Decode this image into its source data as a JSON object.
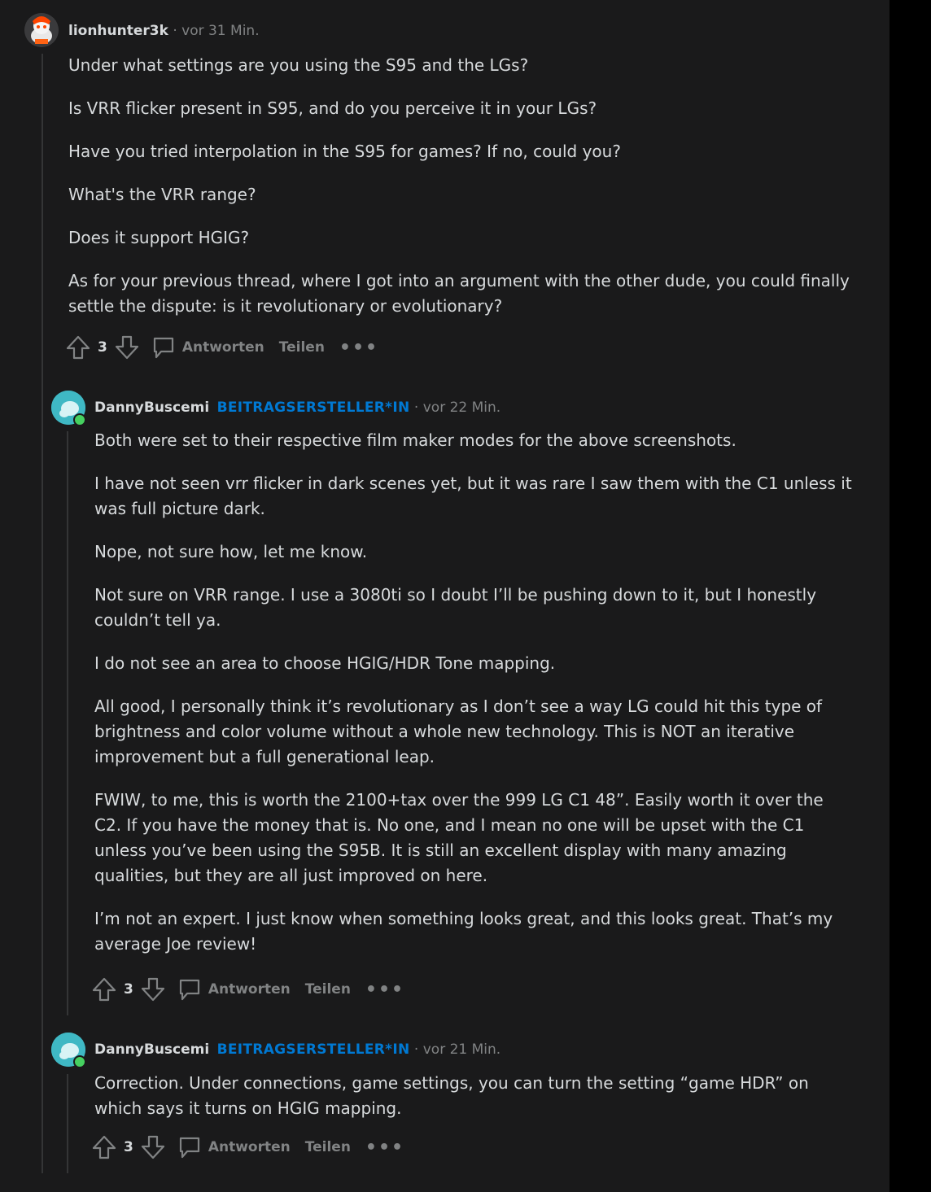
{
  "comments": [
    {
      "user": "lionhunter3k",
      "op_label": "",
      "time": "· vor 31 Min.",
      "paragraphs": [
        "Under what settings are you using the S95 and the LGs?",
        "Is VRR flicker present in S95, and do you perceive it in your LGs?",
        "Have you tried interpolation in the S95 for games? If no, could you?",
        "What's the VRR range?",
        "Does it support HGIG?",
        "As for your previous thread, where I got into an argument with the other dude, you could finally settle the dispute: is it revolutionary or evolutionary?"
      ],
      "score": "3",
      "reply": "Antworten",
      "share": "Teilen",
      "more": "•••"
    },
    {
      "user": "DannyBuscemi",
      "op_label": "BEITRAGSERSTELLER*IN",
      "time": "· vor 22 Min.",
      "paragraphs": [
        "Both were set to their respective film maker modes for the above screenshots.",
        "I have not seen vrr flicker in dark scenes yet, but it was rare I saw them with the C1 unless it was full picture dark.",
        "Nope, not sure how, let me know.",
        "Not sure on VRR range. I use a 3080ti so I doubt I’ll be pushing down to it, but I honestly couldn’t tell ya.",
        "I do not see an area to choose HGIG/HDR Tone mapping.",
        "All good, I personally think it’s revolutionary as I don’t see a way LG could hit this type of brightness and color volume without a whole new technology. This is NOT an iterative improvement but a full generational leap.",
        "FWIW, to me, this is worth the 2100+tax over the 999 LG C1 48”. Easily worth it over the C2. If you have the money that is. No one, and I mean no one will be upset with the C1 unless you’ve been using the S95B. It is still an excellent display with many amazing qualities, but they are all just improved on here.",
        "I’m not an expert. I just know when something looks great, and this looks great. That’s my average Joe review!"
      ],
      "score": "3",
      "reply": "Antworten",
      "share": "Teilen",
      "more": "•••"
    },
    {
      "user": "DannyBuscemi",
      "op_label": "BEITRAGSERSTELLER*IN",
      "time": "· vor 21 Min.",
      "paragraphs": [
        "Correction. Under connections, game settings, you can turn the setting “game HDR” on which says it turns on HGIG mapping."
      ],
      "score": "3",
      "reply": "Antworten",
      "share": "Teilen",
      "more": "•••"
    }
  ],
  "colors": {
    "background": "#1a1a1b",
    "text": "#d7dadc",
    "meta": "#818384",
    "op": "#0079d3",
    "online": "#46d160"
  },
  "icons": {
    "upvote": "arrow-up-icon",
    "downvote": "arrow-down-icon",
    "reply": "speech-bubble-icon",
    "more": "ellipsis-icon"
  }
}
